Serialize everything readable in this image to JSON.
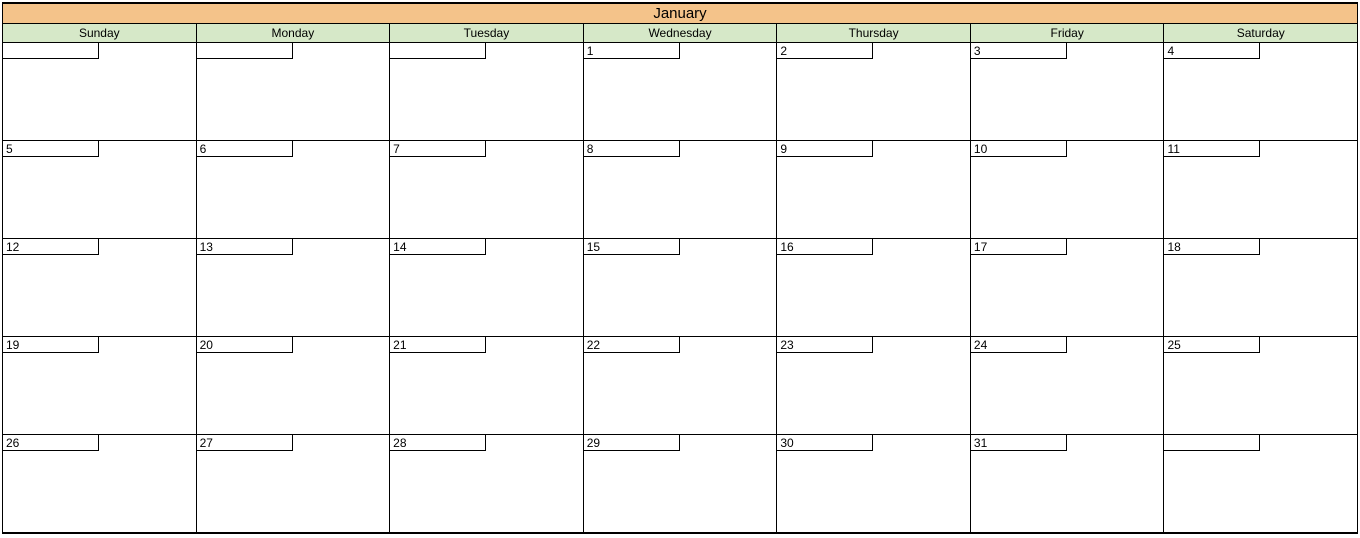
{
  "month": "January",
  "weekdays": [
    "Sunday",
    "Monday",
    "Tuesday",
    "Wednesday",
    "Thursday",
    "Friday",
    "Saturday"
  ],
  "weeks": [
    [
      "",
      "",
      "",
      "1",
      "2",
      "3",
      "4"
    ],
    [
      "5",
      "6",
      "7",
      "8",
      "9",
      "10",
      "11"
    ],
    [
      "12",
      "13",
      "14",
      "15",
      "16",
      "17",
      "18"
    ],
    [
      "19",
      "20",
      "21",
      "22",
      "23",
      "24",
      "25"
    ],
    [
      "26",
      "27",
      "28",
      "29",
      "30",
      "31",
      ""
    ]
  ]
}
